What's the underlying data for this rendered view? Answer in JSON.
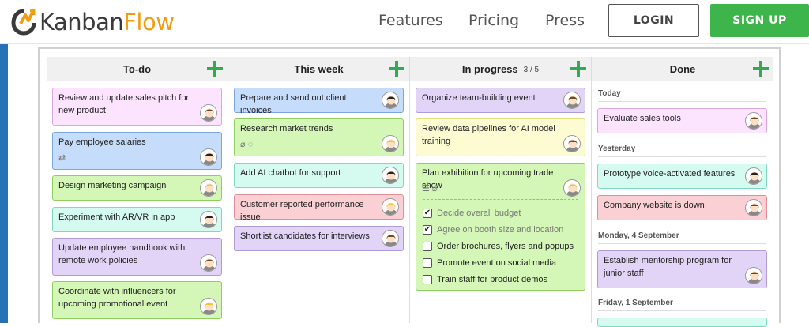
{
  "header": {
    "logo_main": "Kanban",
    "logo_accent": "Flow",
    "nav": [
      "Features",
      "Pricing",
      "Press"
    ],
    "login_label": "LOGIN",
    "signup_label": "SIGN UP"
  },
  "colors": {
    "accent_green": "#3db54a",
    "brand_orange": "#f39c12",
    "left_bar_blue": "#2771b9"
  },
  "columns": [
    {
      "title": "To-do",
      "tasks": [
        {
          "text": "Review and update sales pitch for new product",
          "color": "pink"
        },
        {
          "text": "Pay employee salaries",
          "color": "blue",
          "icons": "repeat-icon"
        },
        {
          "text": "Design marketing campaign",
          "color": "green"
        },
        {
          "text": "Experiment with AR/VR in app",
          "color": "cyan"
        },
        {
          "text": "Update employee handbook with remote work policies",
          "color": "purple"
        },
        {
          "text": "Coordinate with influencers for upcoming promotional event",
          "color": "green"
        }
      ]
    },
    {
      "title": "This week",
      "tasks": [
        {
          "text": "Prepare and send out client invoices",
          "color": "blue"
        },
        {
          "text": "Research market trends",
          "color": "green",
          "icons": "attachment-icon comment-icon"
        },
        {
          "text": "Add AI chatbot for support",
          "color": "cyan"
        },
        {
          "text": "Customer reported performance issue",
          "color": "red"
        },
        {
          "text": "Shortlist candidates for interviews",
          "color": "purple"
        }
      ]
    },
    {
      "title": "In progress",
      "wip": "3 / 5",
      "tasks": [
        {
          "text": "Organize team-building event",
          "color": "purple"
        },
        {
          "text": "Review data pipelines for AI model training",
          "color": "yellow"
        },
        {
          "text": "Plan exhibition for upcoming trade show",
          "color": "green",
          "subtasks": [
            {
              "text": "Decide overall budget",
              "done": true
            },
            {
              "text": "Agree on booth size and location",
              "done": true
            },
            {
              "text": "Order brochures, flyers and popups",
              "done": false
            },
            {
              "text": "Promote event on social media",
              "done": false
            },
            {
              "text": "Train staff for product demos",
              "done": false
            }
          ]
        }
      ]
    },
    {
      "title": "Done",
      "groups": [
        {
          "label": "Today",
          "tasks": [
            {
              "text": "Evaluate sales tools",
              "color": "pink"
            }
          ]
        },
        {
          "label": "Yesterday",
          "tasks": [
            {
              "text": "Prototype voice-activated features",
              "color": "cyan"
            },
            {
              "text": "Company website is down",
              "color": "red"
            }
          ]
        },
        {
          "label": "Monday, 4 September",
          "tasks": [
            {
              "text": "Establish mentorship program for junior staff",
              "color": "purple"
            }
          ]
        },
        {
          "label": "Friday, 1 September",
          "tasks": []
        }
      ]
    }
  ]
}
